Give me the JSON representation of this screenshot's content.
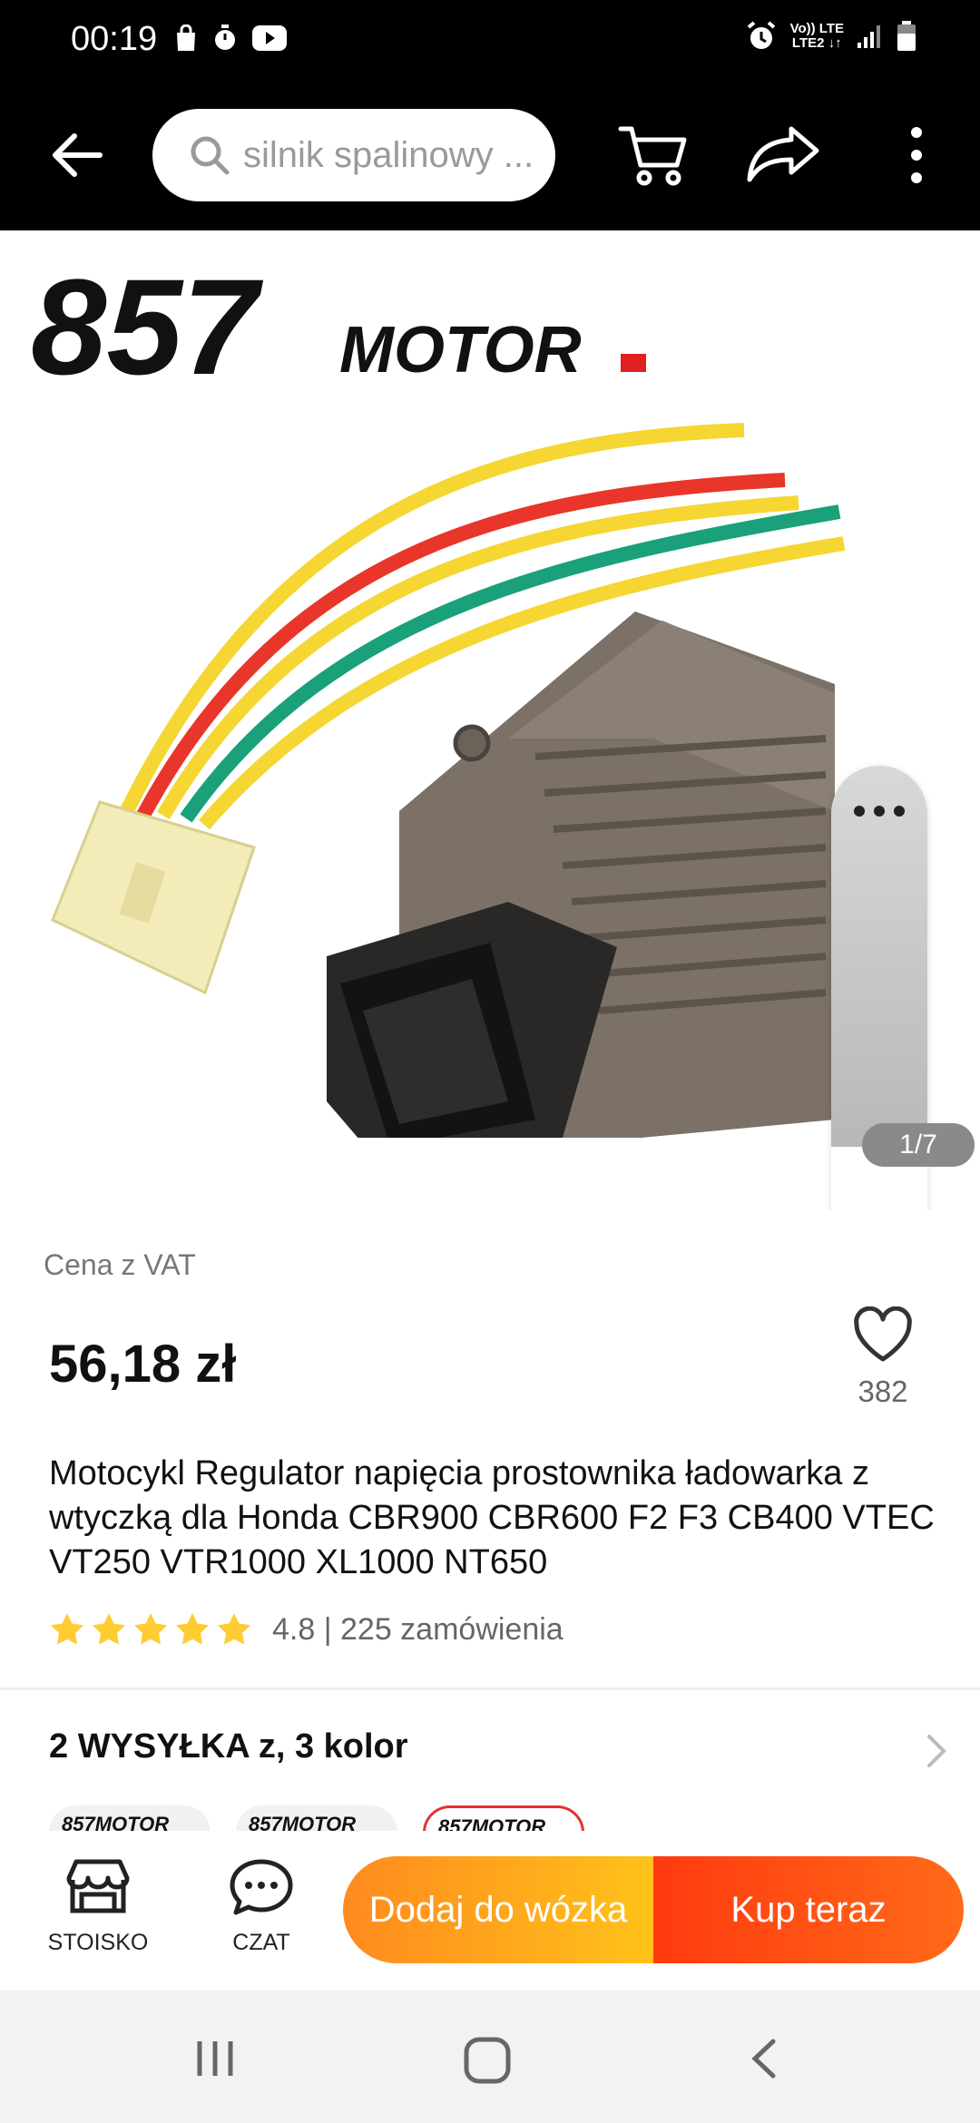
{
  "status_bar": {
    "time": "00:19",
    "network_top": "Vo)) LTE",
    "network_bottom": "LTE2 ↓↑"
  },
  "app_bar": {
    "search_placeholder": "silnik spalinowy ..."
  },
  "gallery": {
    "brand_digits": "857",
    "brand_word": "MOTOR",
    "page_indicator": "1/7"
  },
  "product": {
    "vat_label": "Cena z VAT",
    "price": "56,18 zł",
    "wishlist_count": "382",
    "title": "Motocykl Regulator napięcia prostownika ładowarka z wtyczką dla Honda CBR900 CBR600 F2 F3 CB400 VTEC VT250 VTR1000 XL1000 NT650",
    "rating": "4.8",
    "orders": "225 zamówienia",
    "stars": 5
  },
  "shipping": {
    "label": "2 WYSYŁKA z, 3 kolor"
  },
  "variants": [
    "857MOTOR",
    "857MOTOR",
    "857MOTOR"
  ],
  "action_bar": {
    "store_label": "STOISKO",
    "chat_label": "CZAT",
    "add_to_cart_label": "Dodaj do wózka",
    "buy_now_label": "Kup teraz"
  },
  "colors": {
    "accent_orange": "#ff8a1e",
    "accent_red": "#ff3a10",
    "star_yellow": "#ffcc33",
    "selected_variant_border": "#e63232"
  }
}
